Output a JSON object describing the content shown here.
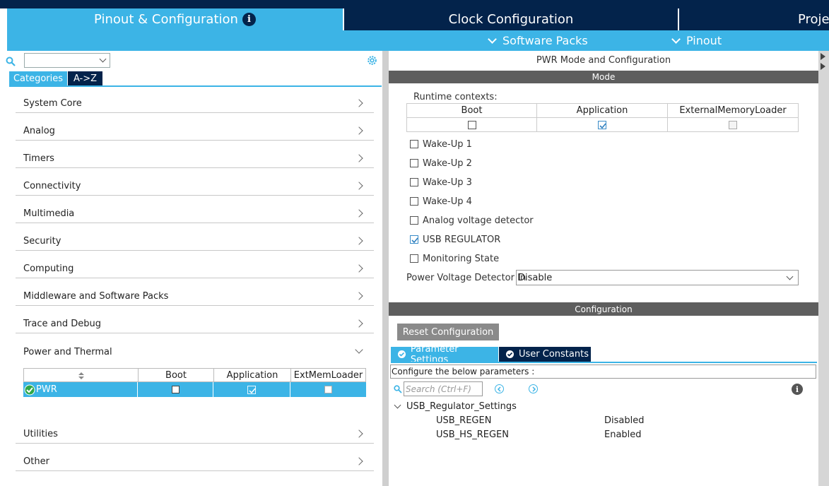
{
  "tabs": {
    "pinout": "Pinout & Configuration",
    "clock": "Clock Configuration",
    "project": "Proje"
  },
  "submenu": {
    "software_packs": "Software Packs",
    "pinout": "Pinout"
  },
  "left": {
    "categories_tab": "Categories",
    "az_tab": "A->Z",
    "items": [
      {
        "label": "System Core"
      },
      {
        "label": "Analog"
      },
      {
        "label": "Timers"
      },
      {
        "label": "Connectivity"
      },
      {
        "label": "Multimedia"
      },
      {
        "label": "Security"
      },
      {
        "label": "Computing"
      },
      {
        "label": "Middleware and Software Packs"
      },
      {
        "label": "Trace and Debug"
      },
      {
        "label": "Power and Thermal"
      },
      {
        "label": "Utilities"
      },
      {
        "label": "Other"
      }
    ],
    "pwr_table": {
      "headers": [
        "",
        "Boot",
        "Application",
        "ExtMemLoader"
      ],
      "row": {
        "name": "PWR",
        "boot": false,
        "application": true,
        "extmemloader": false
      }
    }
  },
  "right": {
    "title": "PWR Mode and Configuration",
    "mode_header": "Mode",
    "runtime_label": "Runtime contexts:",
    "contexts": {
      "headers": [
        "Boot",
        "Application",
        "ExternalMemoryLoader"
      ],
      "checked": [
        false,
        true,
        false
      ]
    },
    "options": [
      {
        "label": "Wake-Up 1",
        "checked": false
      },
      {
        "label": "Wake-Up 2",
        "checked": false
      },
      {
        "label": "Wake-Up 3",
        "checked": false
      },
      {
        "label": "Wake-Up 4",
        "checked": false
      },
      {
        "label": "Analog voltage detector",
        "checked": false
      },
      {
        "label": "USB REGULATOR",
        "checked": true
      },
      {
        "label": "Monitoring State",
        "checked": false
      }
    ],
    "pvd_label": "Power Voltage Detector In",
    "pvd_value": "Disable",
    "config_header": "Configuration",
    "reset_button": "Reset Configuration",
    "param_tab": "Parameter Settings",
    "user_tab": "User Constants",
    "hint": "Configure the below parameters :",
    "search_placeholder": "Search (Ctrl+F)",
    "group": "USB_Regulator_Settings",
    "params": [
      {
        "name": "USB_REGEN",
        "value": "Disabled"
      },
      {
        "name": "USB_HS_REGEN",
        "value": "Enabled"
      }
    ]
  },
  "colors": {
    "accent": "#3cb4e6",
    "dark": "#03234b",
    "section_bar": "#5e5e5e"
  }
}
